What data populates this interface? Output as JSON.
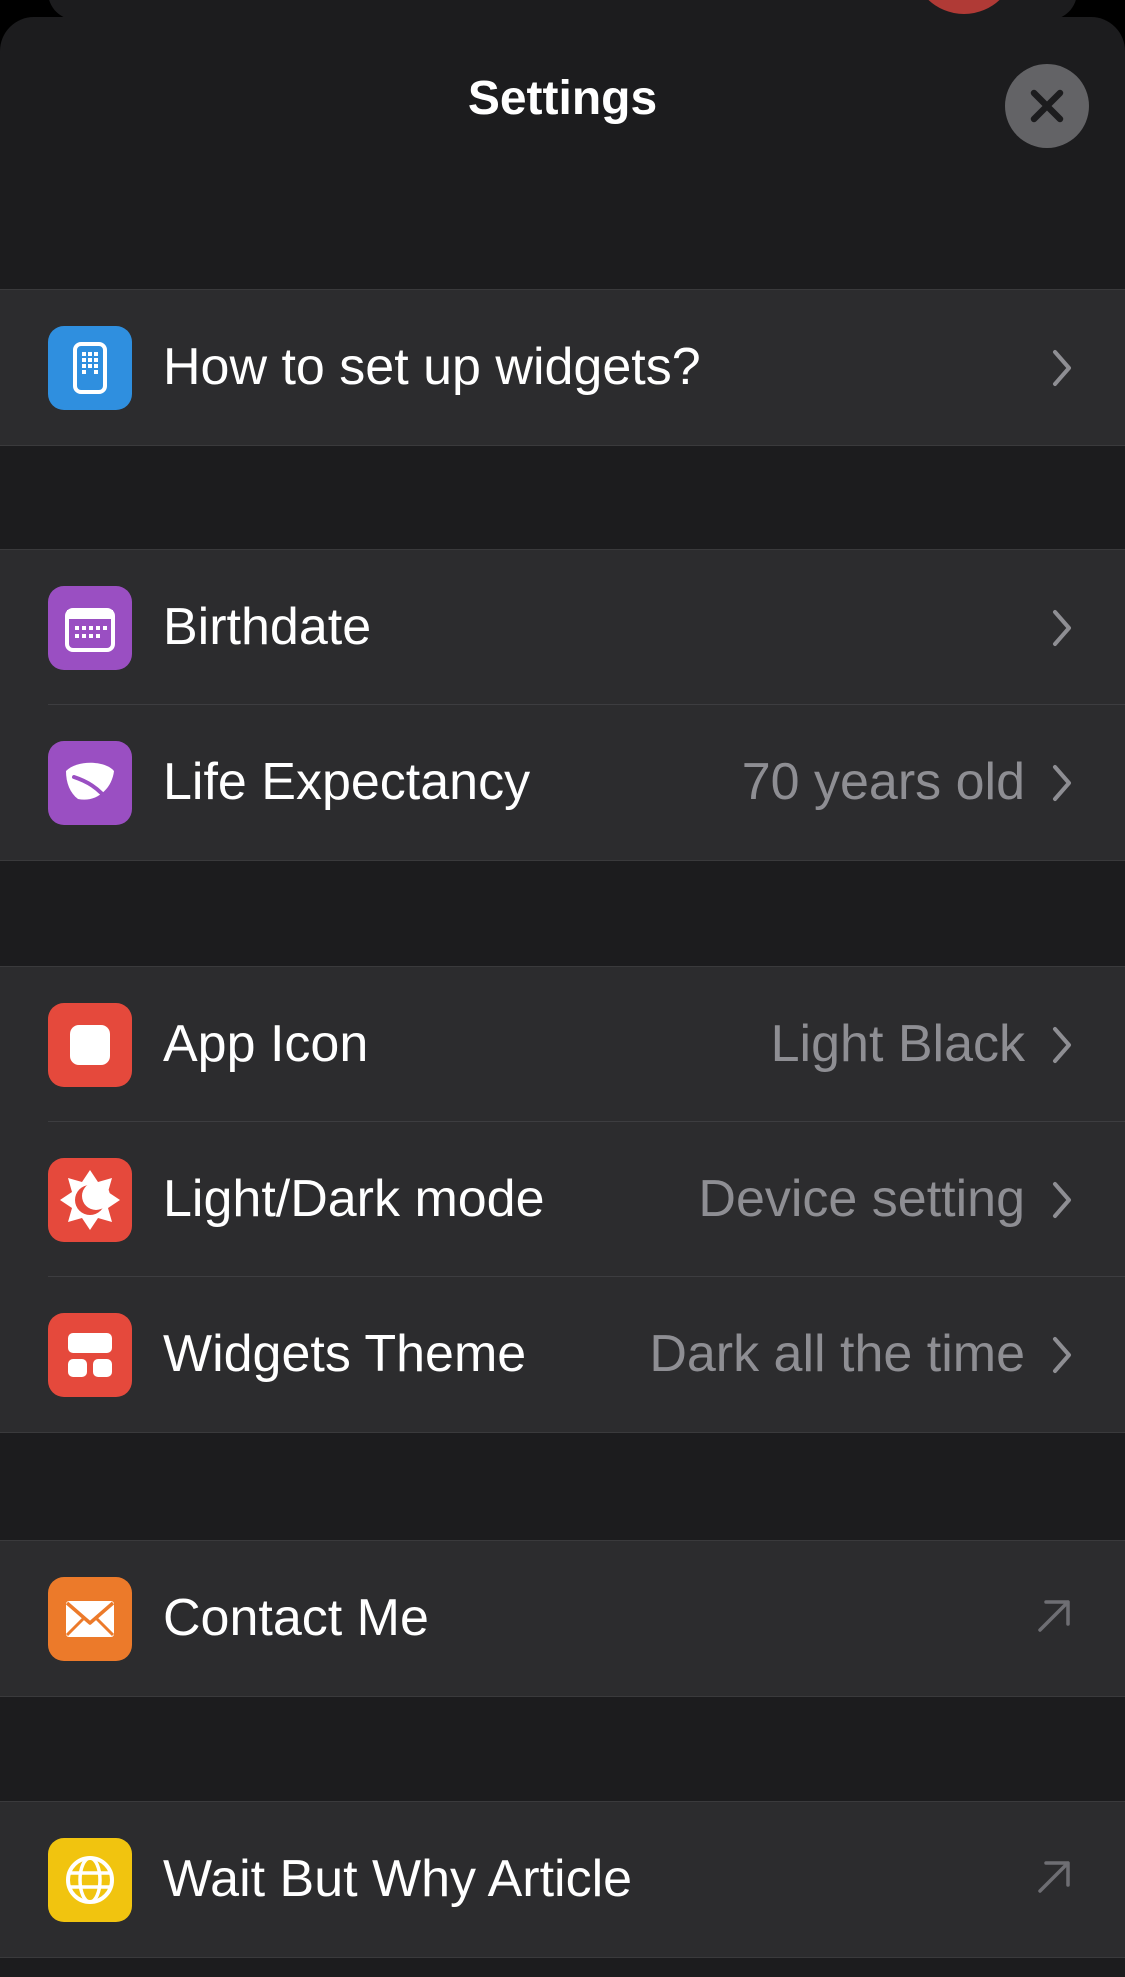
{
  "header": {
    "title": "Settings",
    "close_icon": "close-icon"
  },
  "colors": {
    "background": "#1c1c1e",
    "cell": "#2c2c2e",
    "secondary_text": "#8e8e93",
    "blue": "#2f8fdf",
    "purple": "#9a4fc2",
    "red": "#e5493c",
    "orange": "#ec7a2a",
    "yellow": "#f1c40f"
  },
  "sections": [
    {
      "rows": [
        {
          "label": "How to set up widgets?",
          "value": "",
          "icon": "phone-widget-icon",
          "accessory": "chevron-right-icon"
        }
      ]
    },
    {
      "rows": [
        {
          "label": "Birthdate",
          "value": "",
          "icon": "calendar-icon",
          "accessory": "chevron-right-icon"
        },
        {
          "label": "Life Expectancy",
          "value": "70 years old",
          "icon": "leaf-icon",
          "accessory": "chevron-right-icon"
        }
      ]
    },
    {
      "rows": [
        {
          "label": "App Icon",
          "value": "Light Black",
          "icon": "app-icon-square-icon",
          "accessory": "chevron-right-icon"
        },
        {
          "label": "Light/Dark mode",
          "value": "Device setting",
          "icon": "sun-moon-icon",
          "accessory": "chevron-right-icon"
        },
        {
          "label": "Widgets Theme",
          "value": "Dark all the time",
          "icon": "widget-layout-icon",
          "accessory": "chevron-right-icon"
        }
      ]
    },
    {
      "rows": [
        {
          "label": "Contact Me",
          "value": "",
          "icon": "envelope-icon",
          "accessory": "external-link-arrow-icon"
        }
      ]
    },
    {
      "rows": [
        {
          "label": "Wait But Why Article",
          "value": "",
          "icon": "globe-icon",
          "accessory": "external-link-arrow-icon"
        }
      ]
    }
  ]
}
